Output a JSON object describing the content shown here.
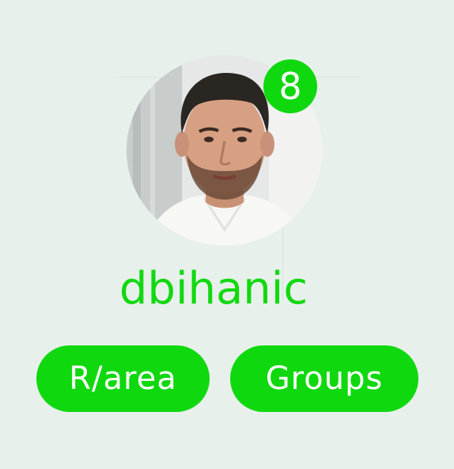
{
  "profile": {
    "username": "dbihanic",
    "badge_count": "8"
  },
  "actions": {
    "area_label": "R/area",
    "groups_label": "Groups"
  },
  "colors": {
    "accent": "#0fd80f",
    "background": "#e8f0eb",
    "text_on_accent": "#ffffff"
  },
  "icons": {
    "avatar": "profile-photo",
    "badge": "notification-count-badge"
  }
}
